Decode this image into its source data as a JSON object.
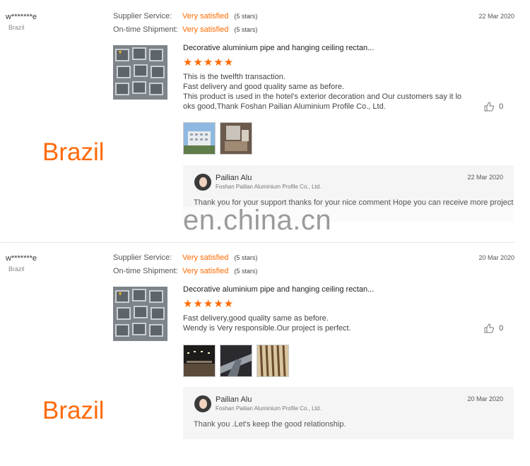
{
  "reviews": [
    {
      "user": "w*******e",
      "country": "Brazil",
      "supplier_label": "Supplier Service:",
      "supplier_value": "Very satisfied",
      "supplier_stars": "(5 stars)",
      "shipment_label": "On-time Shipment:",
      "shipment_value": "Very satisfied",
      "shipment_stars": "(5 stars)",
      "date": "22 Mar 2020",
      "product_title": "Decorative aluminium pipe and hanging ceiling rectan...",
      "rating": "★★★★★",
      "comment_lines": [
        "This is the twelfth transaction.",
        "Fast delivery and good quality same as before.",
        "This product is used in the hotel's exterior decoration and Our customers say it lo",
        "oks good,Thank Foshan Pailian Aluminium Profile Co., Ltd."
      ],
      "likes": "0",
      "overlay_country": "Brazil",
      "reply": {
        "name": "Pailian Alu",
        "company": "Foshan Pailian Aluminium Profile Co., Ltd.",
        "date": "22 Mar 2020",
        "text": "Thank you for your support thanks for your nice comment  Hope you can receive more project"
      }
    },
    {
      "user": "w*******e",
      "country": "Brazil",
      "supplier_label": "Supplier Service:",
      "supplier_value": "Very satisfied",
      "supplier_stars": "(5 stars)",
      "shipment_label": "On-time Shipment:",
      "shipment_value": "Very satisfied",
      "shipment_stars": "(5 stars)",
      "date": "20 Mar 2020",
      "product_title": "Decorative aluminium pipe and hanging ceiling rectan...",
      "rating": "★★★★★",
      "comment_lines": [
        "Fast delivery,good quality same as before.",
        "Wendy is Very responsible.Our project is perfect."
      ],
      "likes": "0",
      "overlay_country": "Brazil",
      "reply": {
        "name": "Pailian Alu",
        "company": "Foshan Pailian Aluminium Profile Co., Ltd.",
        "date": "20 Mar 2020",
        "text": "Thank you  .Let's keep the good relationship."
      }
    }
  ],
  "watermark": "en.china.cn",
  "icons": {
    "like": "thumbs-up-icon"
  },
  "colors": {
    "accent": "#ff6a00",
    "overlay_text": "#ff6a0a"
  }
}
